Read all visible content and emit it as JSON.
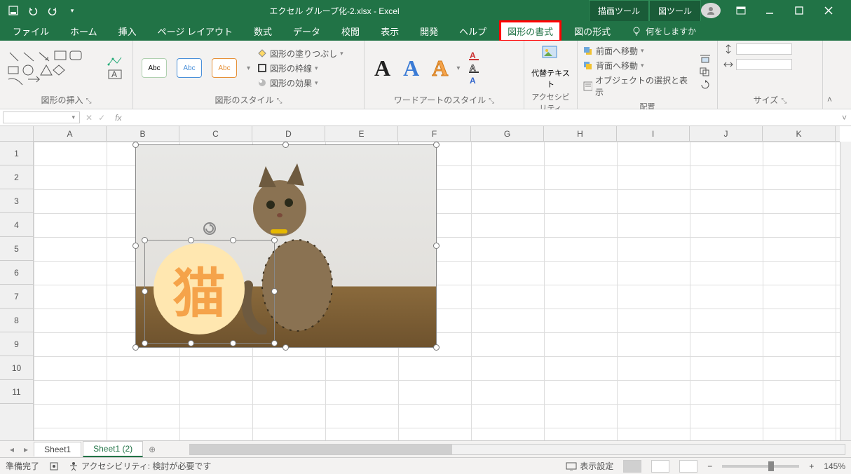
{
  "title": "エクセル グループ化-2.xlsx - Excel",
  "toolTabs": [
    "描画ツール",
    "図ツール"
  ],
  "tabs": [
    "ファイル",
    "ホーム",
    "挿入",
    "ページ レイアウト",
    "数式",
    "データ",
    "校閲",
    "表示",
    "開発",
    "ヘルプ",
    "図形の書式",
    "図の形式"
  ],
  "activeTab": "図形の書式",
  "search": {
    "placeholder": "何をしますか"
  },
  "ribbon": {
    "group1": {
      "label": "図形の挿入"
    },
    "group2": {
      "label": "図形のスタイル",
      "sample": "Abc",
      "fill": "図形の塗りつぶし",
      "outline": "図形の枠線",
      "effects": "図形の効果"
    },
    "group3": {
      "label": "ワードアートのスタイル"
    },
    "group4": {
      "label": "アクセシビリティ",
      "alt": "代替テキスト"
    },
    "group5": {
      "label": "配置",
      "front": "前面へ移動",
      "back": "背面へ移動",
      "select": "オブジェクトの選択と表示"
    },
    "group6": {
      "label": "サイズ"
    }
  },
  "nameBox": "",
  "columns": [
    "A",
    "B",
    "C",
    "D",
    "E",
    "F",
    "G",
    "H",
    "I",
    "J",
    "K"
  ],
  "rows": [
    "1",
    "2",
    "3",
    "4",
    "5",
    "6",
    "7",
    "8",
    "9",
    "10",
    "11"
  ],
  "shapeText": "猫",
  "sheetTabs": [
    "Sheet1",
    "Sheet1 (2)"
  ],
  "activeSheet": "Sheet1 (2)",
  "status": {
    "ready": "準備完了",
    "acc": "アクセシビリティ: 検討が必要です",
    "display": "表示設定",
    "zoom": "145%"
  }
}
